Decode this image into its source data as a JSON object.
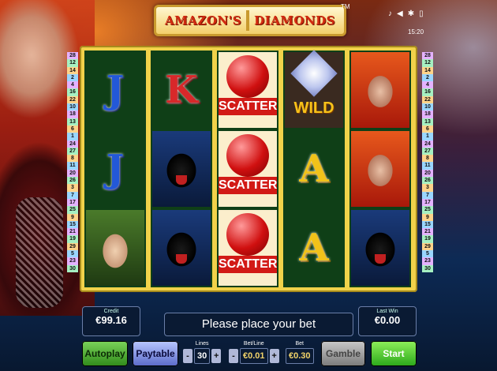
{
  "game": {
    "title_left": "AMAZON'S",
    "title_right": "DIAMONDS",
    "trademark": "TM",
    "clock": "15:20"
  },
  "reels": [
    [
      "J",
      "J",
      "woman-green"
    ],
    [
      "K",
      "panther",
      "panther"
    ],
    [
      "SCATTER",
      "SCATTER",
      "SCATTER"
    ],
    [
      "WILD",
      "A",
      "A"
    ],
    [
      "woman-red",
      "woman-red",
      "panther"
    ]
  ],
  "symbol_text": {
    "scatter": "SCATTER",
    "wild": "WILD"
  },
  "paylines_left": [
    "28",
    "12",
    "14",
    "2",
    "4",
    "16",
    "22",
    "10",
    "18",
    "13",
    "6",
    "1",
    "24",
    "27",
    "8",
    "11",
    "20",
    "26",
    "3",
    "7",
    "17",
    "25",
    "9",
    "15",
    "21",
    "19",
    "29",
    "5",
    "23",
    "30"
  ],
  "paylines_right": [
    "28",
    "12",
    "14",
    "2",
    "4",
    "16",
    "22",
    "10",
    "18",
    "13",
    "6",
    "1",
    "24",
    "27",
    "8",
    "11",
    "20",
    "26",
    "3",
    "7",
    "17",
    "25",
    "9",
    "15",
    "21",
    "19",
    "29",
    "5",
    "23",
    "30"
  ],
  "panel": {
    "credit_label": "Credit",
    "credit_value": "€99.16",
    "message": "Please place your bet",
    "last_win_label": "Last Win",
    "last_win_value": "€0.00",
    "lines_label": "Lines",
    "lines_value": "30",
    "betline_label": "Bet/Line",
    "betline_value": "€0.01",
    "bet_label": "Bet",
    "bet_value": "€0.30"
  },
  "buttons": {
    "autoplay": "Autoplay",
    "paytable": "Paytable",
    "gamble": "Gamble",
    "start": "Start",
    "minus": "-",
    "plus": "+"
  },
  "colors": {
    "frame": "#f1d24a",
    "reel_bg": "#0f3f17",
    "start": "#2aa81a",
    "autoplay": "#2f8a1a",
    "paytable": "#5a6ac9"
  }
}
